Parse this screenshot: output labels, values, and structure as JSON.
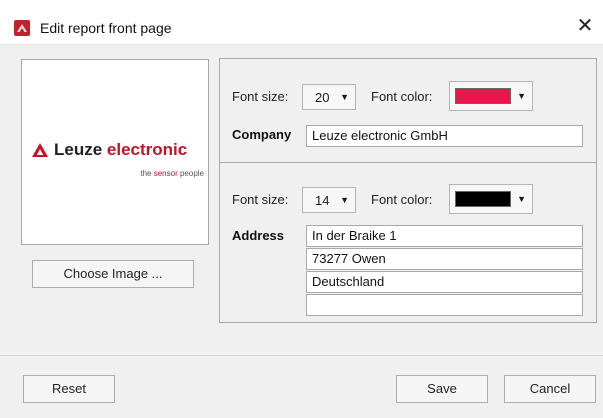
{
  "window": {
    "title": "Edit report front page",
    "close_symbol": "✕",
    "icon": "report-app-icon"
  },
  "logo": {
    "brand_part1": "Leuze",
    "brand_part2": "electronic",
    "tagline_pre": "the",
    "tagline_highlight": "sensor",
    "tagline_post": "people",
    "accent_color": "#c4122a"
  },
  "buttons": {
    "choose_image": "Choose Image ...",
    "reset": "Reset",
    "save": "Save",
    "cancel": "Cancel"
  },
  "company_section": {
    "font_size_label": "Font size:",
    "font_size_value": "20",
    "font_color_label": "Font color:",
    "font_color": "#e8174b",
    "field_label": "Company",
    "value": "Leuze electronic GmbH"
  },
  "address_section": {
    "font_size_label": "Font size:",
    "font_size_value": "14",
    "font_color_label": "Font color:",
    "font_color": "#000000",
    "field_label": "Address",
    "lines": [
      "In der Braike 1",
      "73277 Owen",
      "Deutschland",
      ""
    ]
  },
  "icons": {
    "dropdown_caret": "▼"
  }
}
